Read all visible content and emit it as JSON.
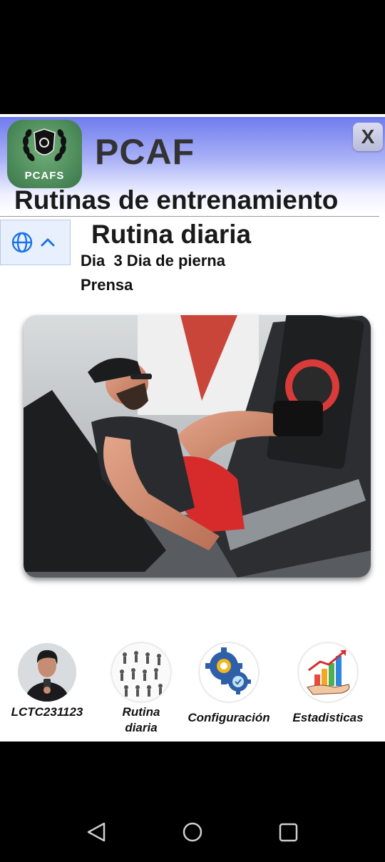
{
  "app": {
    "logo_text": "PCAFS",
    "brand": "PCAF",
    "close_label": "X",
    "title": "Rutinas de entrenamiento",
    "subtitle": "Rutina diaria",
    "day_text": "Dia  3 Dia de pierna",
    "exercise": "Prensa"
  },
  "language_selector": {
    "icons": [
      "globe-icon",
      "chevron-up-icon"
    ],
    "accent": "#1a73e8"
  },
  "exercise_image": {
    "description_icon": "leg-press-photo"
  },
  "bottom_nav": [
    {
      "label": "LCTC231123",
      "icon": "profile-avatar"
    },
    {
      "label": "Rutina diaria",
      "icon": "exercise-chart-icon"
    },
    {
      "label": "Configuración",
      "icon": "gears-icon"
    },
    {
      "label": "Estadisticas",
      "icon": "growth-chart-icon"
    }
  ],
  "colors": {
    "header_gradient_top": "#6a78ee",
    "header_gradient_bottom": "#ffffff",
    "text": "#1a1a1a"
  }
}
